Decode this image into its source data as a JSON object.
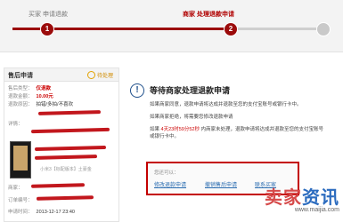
{
  "steps": {
    "step1_label": "买家 申请退款",
    "step2_label": "商家 处理退款申请",
    "step1_number": "1",
    "step2_number": "2"
  },
  "left_panel": {
    "title": "售后申请",
    "status_tag": "待处理",
    "type_label": "售后类型：",
    "type_value": "仅退款",
    "amount_label": "退款金额：",
    "amount_value": "10.00元",
    "reason_label": "退款原因：",
    "reason_value": "拍错/多拍/不喜欢",
    "detail_label": "详情：",
    "seller_label": "商家：",
    "order_label": "订单编号：",
    "time_label": "申请时间：",
    "time_value": "2013-12-17 23:40",
    "product_note": "小米3【标配版本】土豪金"
  },
  "right_panel": {
    "title": "等待商家处理退款申请",
    "line1": "如果商家同意，退款申请将达成并退款至您的支付宝账号或银行卡中。",
    "line2": "如果商家拒绝，将需要您修改退款申请",
    "line3_prefix": "如果",
    "line3_countdown": "4天23时59分52秒",
    "line3_suffix": "内商家未处理，退款申请将达成并退款至您的支付宝账号或银行卡中。",
    "action_box": {
      "label": "您还可以：",
      "btn1": "修改退款申请",
      "btn2": "撤销售后申请",
      "btn3": "联系买家"
    }
  },
  "watermark": {
    "text_a": "卖家",
    "text_b": "资讯",
    "url": "www.maijia.com"
  }
}
